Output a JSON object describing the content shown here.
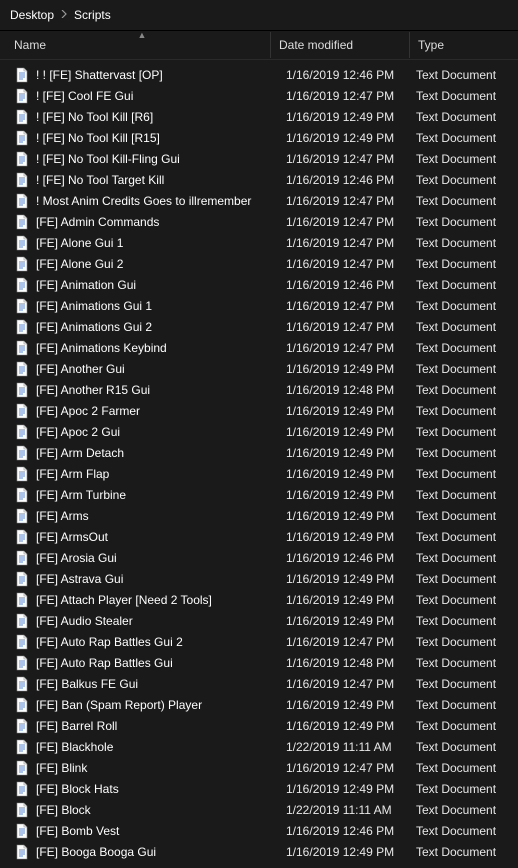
{
  "breadcrumb": {
    "items": [
      "Desktop",
      "Scripts"
    ]
  },
  "columns": {
    "name": "Name",
    "date": "Date modified",
    "type": "Type"
  },
  "default_type": "Text Document",
  "files": [
    {
      "name": "! ! [FE] Shattervast [OP]",
      "date": "1/16/2019 12:46 PM",
      "type": "Text Document"
    },
    {
      "name": "! [FE] Cool FE Gui",
      "date": "1/16/2019 12:47 PM",
      "type": "Text Document"
    },
    {
      "name": "! [FE] No Tool Kill [R6]",
      "date": "1/16/2019 12:49 PM",
      "type": "Text Document"
    },
    {
      "name": "! [FE] No Tool Kill [R15]",
      "date": "1/16/2019 12:49 PM",
      "type": "Text Document"
    },
    {
      "name": "! [FE] No Tool Kill-Fling Gui",
      "date": "1/16/2019 12:47 PM",
      "type": "Text Document"
    },
    {
      "name": "! [FE] No Tool Target Kill",
      "date": "1/16/2019 12:46 PM",
      "type": "Text Document"
    },
    {
      "name": "! Most Anim Credits Goes to illremember",
      "date": "1/16/2019 12:47 PM",
      "type": "Text Document"
    },
    {
      "name": "[FE] Admin Commands",
      "date": "1/16/2019 12:47 PM",
      "type": "Text Document"
    },
    {
      "name": "[FE] Alone Gui 1",
      "date": "1/16/2019 12:47 PM",
      "type": "Text Document"
    },
    {
      "name": "[FE] Alone Gui 2",
      "date": "1/16/2019 12:47 PM",
      "type": "Text Document"
    },
    {
      "name": "[FE] Animation Gui",
      "date": "1/16/2019 12:46 PM",
      "type": "Text Document"
    },
    {
      "name": "[FE] Animations Gui 1",
      "date": "1/16/2019 12:47 PM",
      "type": "Text Document"
    },
    {
      "name": "[FE] Animations Gui 2",
      "date": "1/16/2019 12:47 PM",
      "type": "Text Document"
    },
    {
      "name": "[FE] Animations Keybind",
      "date": "1/16/2019 12:47 PM",
      "type": "Text Document"
    },
    {
      "name": "[FE] Another Gui",
      "date": "1/16/2019 12:49 PM",
      "type": "Text Document"
    },
    {
      "name": "[FE] Another R15 Gui",
      "date": "1/16/2019 12:48 PM",
      "type": "Text Document"
    },
    {
      "name": "[FE] Apoc 2 Farmer",
      "date": "1/16/2019 12:49 PM",
      "type": "Text Document"
    },
    {
      "name": "[FE] Apoc 2 Gui",
      "date": "1/16/2019 12:49 PM",
      "type": "Text Document"
    },
    {
      "name": "[FE] Arm Detach",
      "date": "1/16/2019 12:49 PM",
      "type": "Text Document"
    },
    {
      "name": "[FE] Arm Flap",
      "date": "1/16/2019 12:49 PM",
      "type": "Text Document"
    },
    {
      "name": "[FE] Arm Turbine",
      "date": "1/16/2019 12:49 PM",
      "type": "Text Document"
    },
    {
      "name": "[FE] Arms",
      "date": "1/16/2019 12:49 PM",
      "type": "Text Document"
    },
    {
      "name": "[FE] ArmsOut",
      "date": "1/16/2019 12:49 PM",
      "type": "Text Document"
    },
    {
      "name": "[FE] Arosia Gui",
      "date": "1/16/2019 12:46 PM",
      "type": "Text Document"
    },
    {
      "name": "[FE] Astrava Gui",
      "date": "1/16/2019 12:49 PM",
      "type": "Text Document"
    },
    {
      "name": "[FE] Attach Player [Need 2 Tools]",
      "date": "1/16/2019 12:49 PM",
      "type": "Text Document"
    },
    {
      "name": "[FE] Audio Stealer",
      "date": "1/16/2019 12:49 PM",
      "type": "Text Document"
    },
    {
      "name": "[FE] Auto Rap Battles Gui 2",
      "date": "1/16/2019 12:47 PM",
      "type": "Text Document"
    },
    {
      "name": "[FE] Auto Rap Battles Gui",
      "date": "1/16/2019 12:48 PM",
      "type": "Text Document"
    },
    {
      "name": "[FE] Balkus FE Gui",
      "date": "1/16/2019 12:47 PM",
      "type": "Text Document"
    },
    {
      "name": "[FE] Ban (Spam Report) Player",
      "date": "1/16/2019 12:49 PM",
      "type": "Text Document"
    },
    {
      "name": "[FE] Barrel Roll",
      "date": "1/16/2019 12:49 PM",
      "type": "Text Document"
    },
    {
      "name": "[FE] Blackhole",
      "date": "1/22/2019 11:11 AM",
      "type": "Text Document"
    },
    {
      "name": "[FE] Blink",
      "date": "1/16/2019 12:47 PM",
      "type": "Text Document"
    },
    {
      "name": "[FE] Block Hats",
      "date": "1/16/2019 12:49 PM",
      "type": "Text Document"
    },
    {
      "name": "[FE] Block",
      "date": "1/22/2019 11:11 AM",
      "type": "Text Document"
    },
    {
      "name": "[FE] Bomb Vest",
      "date": "1/16/2019 12:46 PM",
      "type": "Text Document"
    },
    {
      "name": "[FE] Booga Booga Gui",
      "date": "1/16/2019 12:49 PM",
      "type": "Text Document"
    }
  ]
}
